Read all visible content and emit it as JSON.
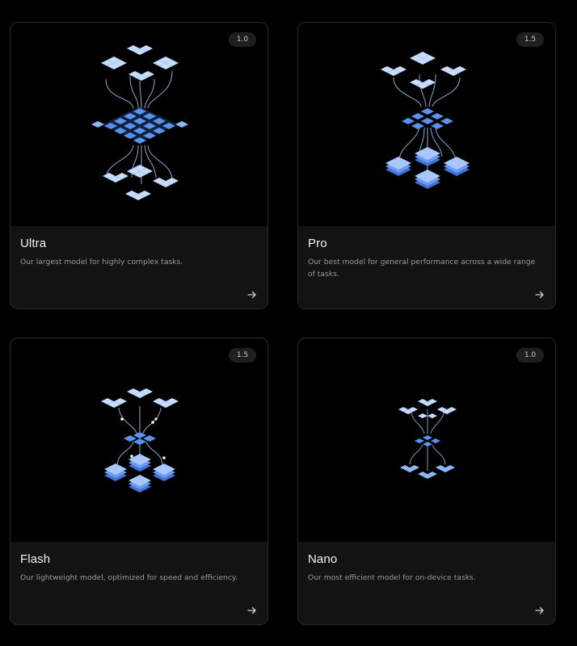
{
  "cards": [
    {
      "badge": "1.0",
      "title": "Ultra",
      "description": "Our largest model for highly complex tasks.",
      "illustration_icon": "model-network-ultra-icon",
      "link_icon": "arrow-right-icon"
    },
    {
      "badge": "1.5",
      "title": "Pro",
      "description": "Our best model for general performance across a wide range of tasks.",
      "illustration_icon": "model-network-pro-icon",
      "link_icon": "arrow-right-icon"
    },
    {
      "badge": "1.5",
      "title": "Flash",
      "description": "Our lightweight model, optimized for speed and efficiency.",
      "illustration_icon": "model-network-flash-icon",
      "link_icon": "arrow-right-icon"
    },
    {
      "badge": "1.0",
      "title": "Nano",
      "description": "Our most efficient model for on-device tasks.",
      "illustration_icon": "model-network-nano-icon",
      "link_icon": "arrow-right-icon"
    }
  ],
  "colors": {
    "background": "#000000",
    "card_info_bg": "#131313",
    "card_border": "#2a2a2a",
    "tile_light": "#c6dcff",
    "tile_mid": "#8fb6f5",
    "tile_dark": "#4a86e8",
    "connector": "#9bb3d6"
  }
}
